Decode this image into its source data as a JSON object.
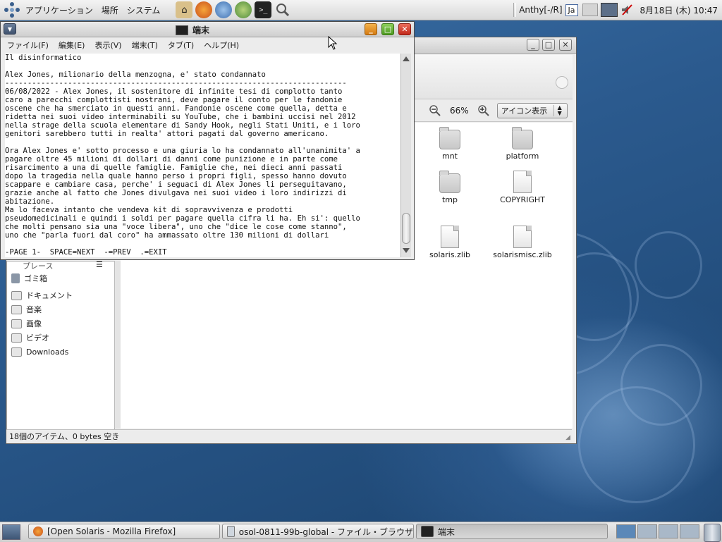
{
  "top_panel": {
    "menus": [
      "アプリケーション",
      "場所",
      "システム"
    ],
    "input_method": "Anthy[-/R]",
    "language": "Ja",
    "clock": "8月18日 (木) 10:47"
  },
  "terminal": {
    "title": "端末",
    "menu": [
      "ファイル(F)",
      "編集(E)",
      "表示(V)",
      "端末(T)",
      "タブ(T)",
      "ヘルプ(H)"
    ],
    "lines": [
      "Il disinformatico",
      "",
      "Alex Jones, milionario della menzogna, e' stato condannato",
      "----------------------------------------------------------------------------",
      "06/08/2022 - Alex Jones, il sostenitore di infinite tesi di complotto tanto",
      "caro a parecchi complottisti nostrani, deve pagare il conto per le fandonie",
      "oscene che ha smerciato in questi anni. Fandonie oscene come quella, detta e",
      "ridetta nei suoi video interminabili su YouTube, che i bambini uccisi nel 2012",
      "nella strage della scuola elementare di Sandy Hook, negli Stati Uniti, e i loro",
      "genitori sarebbero tutti in realta' attori pagati dal governo americano.",
      "",
      "Ora Alex Jones e' sotto processo e una giuria lo ha condannato all'unanimita' a",
      "pagare oltre 45 milioni di dollari di danni come punizione e in parte come",
      "risarcimento a una di quelle famiglie. Famiglie che, nei dieci anni passati",
      "dopo la tragedia nella quale hanno perso i propri figli, spesso hanno dovuto",
      "scappare e cambiare casa, perche' i seguaci di Alex Jones li perseguitavano,",
      "grazie anche al fatto che Jones divulgava nei suoi video i loro indirizzi di",
      "abitazione.",
      "Ma lo faceva intanto che vendeva kit di sopravvivenza e prodotti",
      "pseudomedicinali e quindi i soldi per pagare quella cifra li ha. Eh si': quello",
      "che molti pensano sia una \"voce libera\", uno che \"dice le cose come stanno\",",
      "uno che \"parla fuori dal coro\" ha ammassato oltre 130 milioni di dollari",
      "",
      "-PAGE 1-  SPACE=NEXT  -=PREV  .=EXIT"
    ]
  },
  "file_browser": {
    "zoom": "66%",
    "view_mode": "アイコン表示",
    "items": [
      "mnt",
      "platform",
      "tmp",
      "COPYRIGHT",
      "solaris.zlib",
      "solarismisc.zlib"
    ],
    "sidebar_header": "プレース",
    "sidebar": [
      "ゴミ箱",
      "ドキュメント",
      "音楽",
      "画像",
      "ビデオ",
      "Downloads"
    ],
    "status": "18個のアイテム、0 bytes 空き"
  },
  "taskbar": {
    "tasks": [
      "[Open Solaris - Mozilla Firefox]",
      "osol-0811-99b-global - ファイル・ブラウザ",
      "端末"
    ]
  }
}
